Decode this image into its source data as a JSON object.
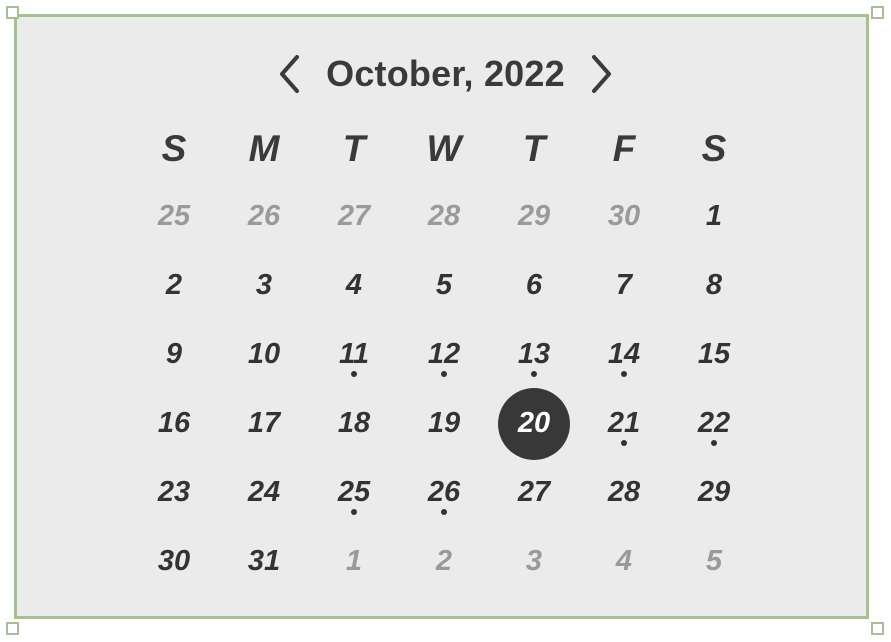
{
  "calendar": {
    "title": "October, 2022",
    "prev_icon": "chevron-left-icon",
    "next_icon": "chevron-right-icon",
    "weekdays": [
      "S",
      "M",
      "T",
      "W",
      "T",
      "F",
      "S"
    ],
    "selected_day": "20",
    "colors": {
      "text": "#333333",
      "muted_text": "#9a9a9a",
      "selected_bg": "#383838",
      "frame_border": "#a9bd96",
      "background": "#ebebeb"
    },
    "weeks": [
      [
        {
          "label": "25",
          "muted": true,
          "event": false
        },
        {
          "label": "26",
          "muted": true,
          "event": false
        },
        {
          "label": "27",
          "muted": true,
          "event": false
        },
        {
          "label": "28",
          "muted": true,
          "event": false
        },
        {
          "label": "29",
          "muted": true,
          "event": false
        },
        {
          "label": "30",
          "muted": true,
          "event": false
        },
        {
          "label": "1",
          "muted": false,
          "event": false
        }
      ],
      [
        {
          "label": "2",
          "muted": false,
          "event": false
        },
        {
          "label": "3",
          "muted": false,
          "event": false
        },
        {
          "label": "4",
          "muted": false,
          "event": false
        },
        {
          "label": "5",
          "muted": false,
          "event": false
        },
        {
          "label": "6",
          "muted": false,
          "event": false
        },
        {
          "label": "7",
          "muted": false,
          "event": false
        },
        {
          "label": "8",
          "muted": false,
          "event": false
        }
      ],
      [
        {
          "label": "9",
          "muted": false,
          "event": false
        },
        {
          "label": "10",
          "muted": false,
          "event": false
        },
        {
          "label": "11",
          "muted": false,
          "event": true
        },
        {
          "label": "12",
          "muted": false,
          "event": true
        },
        {
          "label": "13",
          "muted": false,
          "event": true
        },
        {
          "label": "14",
          "muted": false,
          "event": true
        },
        {
          "label": "15",
          "muted": false,
          "event": false
        }
      ],
      [
        {
          "label": "16",
          "muted": false,
          "event": false
        },
        {
          "label": "17",
          "muted": false,
          "event": false
        },
        {
          "label": "18",
          "muted": false,
          "event": false
        },
        {
          "label": "19",
          "muted": false,
          "event": false
        },
        {
          "label": "20",
          "muted": false,
          "event": false,
          "selected": true
        },
        {
          "label": "21",
          "muted": false,
          "event": true
        },
        {
          "label": "22",
          "muted": false,
          "event": true
        }
      ],
      [
        {
          "label": "23",
          "muted": false,
          "event": false
        },
        {
          "label": "24",
          "muted": false,
          "event": false
        },
        {
          "label": "25",
          "muted": false,
          "event": true
        },
        {
          "label": "26",
          "muted": false,
          "event": true
        },
        {
          "label": "27",
          "muted": false,
          "event": false
        },
        {
          "label": "28",
          "muted": false,
          "event": false
        },
        {
          "label": "29",
          "muted": false,
          "event": false
        }
      ],
      [
        {
          "label": "30",
          "muted": false,
          "event": false
        },
        {
          "label": "31",
          "muted": false,
          "event": false
        },
        {
          "label": "1",
          "muted": true,
          "event": false
        },
        {
          "label": "2",
          "muted": true,
          "event": false
        },
        {
          "label": "3",
          "muted": true,
          "event": false
        },
        {
          "label": "4",
          "muted": true,
          "event": false
        },
        {
          "label": "5",
          "muted": true,
          "event": false
        }
      ]
    ]
  }
}
